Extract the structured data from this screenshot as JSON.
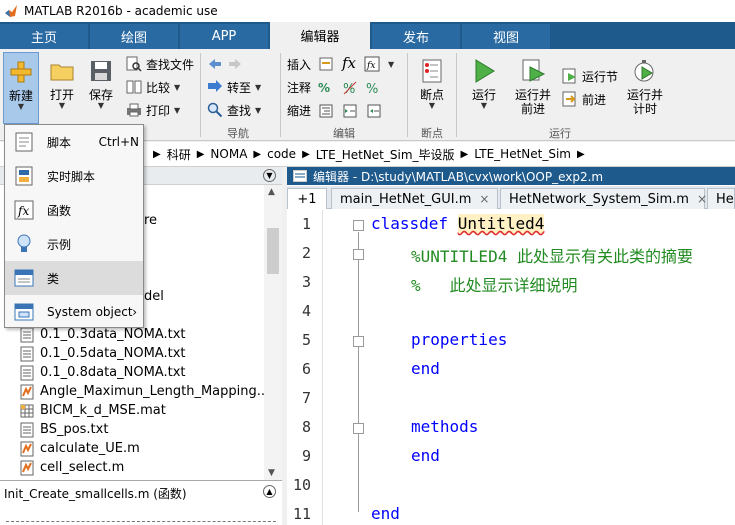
{
  "window": {
    "title": "MATLAB R2016b - academic use"
  },
  "tabs": [
    {
      "label": "主页"
    },
    {
      "label": "绘图"
    },
    {
      "label": "APP"
    },
    {
      "label": "编辑器"
    },
    {
      "label": "发布"
    },
    {
      "label": "视图"
    }
  ],
  "ribbon": {
    "new_label": "新建",
    "open_label": "打开",
    "save_label": "保存",
    "find_files": "查找文件",
    "compare": "比较",
    "print": "打印",
    "goto": "转至",
    "find": "查找",
    "insert": "插入",
    "comment": "注释",
    "indent": "缩进",
    "breakpoints": "断点",
    "run": "运行",
    "run_advance": "运行并\n前进",
    "run_section": "运行节",
    "advance": "前进",
    "run_time": "运行并\n计时",
    "sections": {
      "nav": "导航",
      "edit": "编辑",
      "bp": "断点",
      "run": "运行"
    }
  },
  "breadcrumb": [
    "科研",
    "NOMA",
    "code",
    "LTE_HetNet_Sim_毕设版",
    "LTE_HetNet_Sim"
  ],
  "new_menu": {
    "items": [
      {
        "label": "脚本",
        "shortcut": "Ctrl+N"
      },
      {
        "label": "实时脚本",
        "shortcut": ""
      },
      {
        "label": "函数",
        "shortcut": ""
      },
      {
        "label": "示例",
        "shortcut": ""
      },
      {
        "label": "类",
        "shortcut": ""
      },
      {
        "label": "System object",
        "shortcut": ""
      }
    ]
  },
  "files": {
    "partial1": "re",
    "partial2": "del",
    "items": [
      "0.1_0.3data_NOMA.txt",
      "0.1_0.5data_NOMA.txt",
      "0.1_0.8data_NOMA.txt",
      "Angle_Maximun_Length_Mapping...",
      "BICM_k_d_MSE.mat",
      "BS_pos.txt",
      "calculate_UE.m",
      "cell_select.m"
    ]
  },
  "details": {
    "title": "Init_Create_smallcells.m  (函数)"
  },
  "editor": {
    "title": "编辑器 - D:\\study\\MATLAB\\cvx\\work\\OOP_exp2.m",
    "tabs": [
      {
        "label": "main_HetNet_GUI.m"
      },
      {
        "label": "HetNetwork_System_Sim.m"
      },
      {
        "label": "He"
      }
    ],
    "plus_label": "+1",
    "line_numbers": [
      "1",
      "2",
      "3",
      "4",
      "5",
      "6",
      "7",
      "8",
      "9",
      "10",
      "11"
    ],
    "code": {
      "l1_kw": "classdef",
      "l1_name": "Untitled4",
      "l2": "%UNTITLED4 此处显示有关此类的摘要",
      "l3": "%   此处显示详细说明",
      "l5": "properties",
      "l6": "end",
      "l8": "methods",
      "l9": "end",
      "l11": "end"
    }
  }
}
